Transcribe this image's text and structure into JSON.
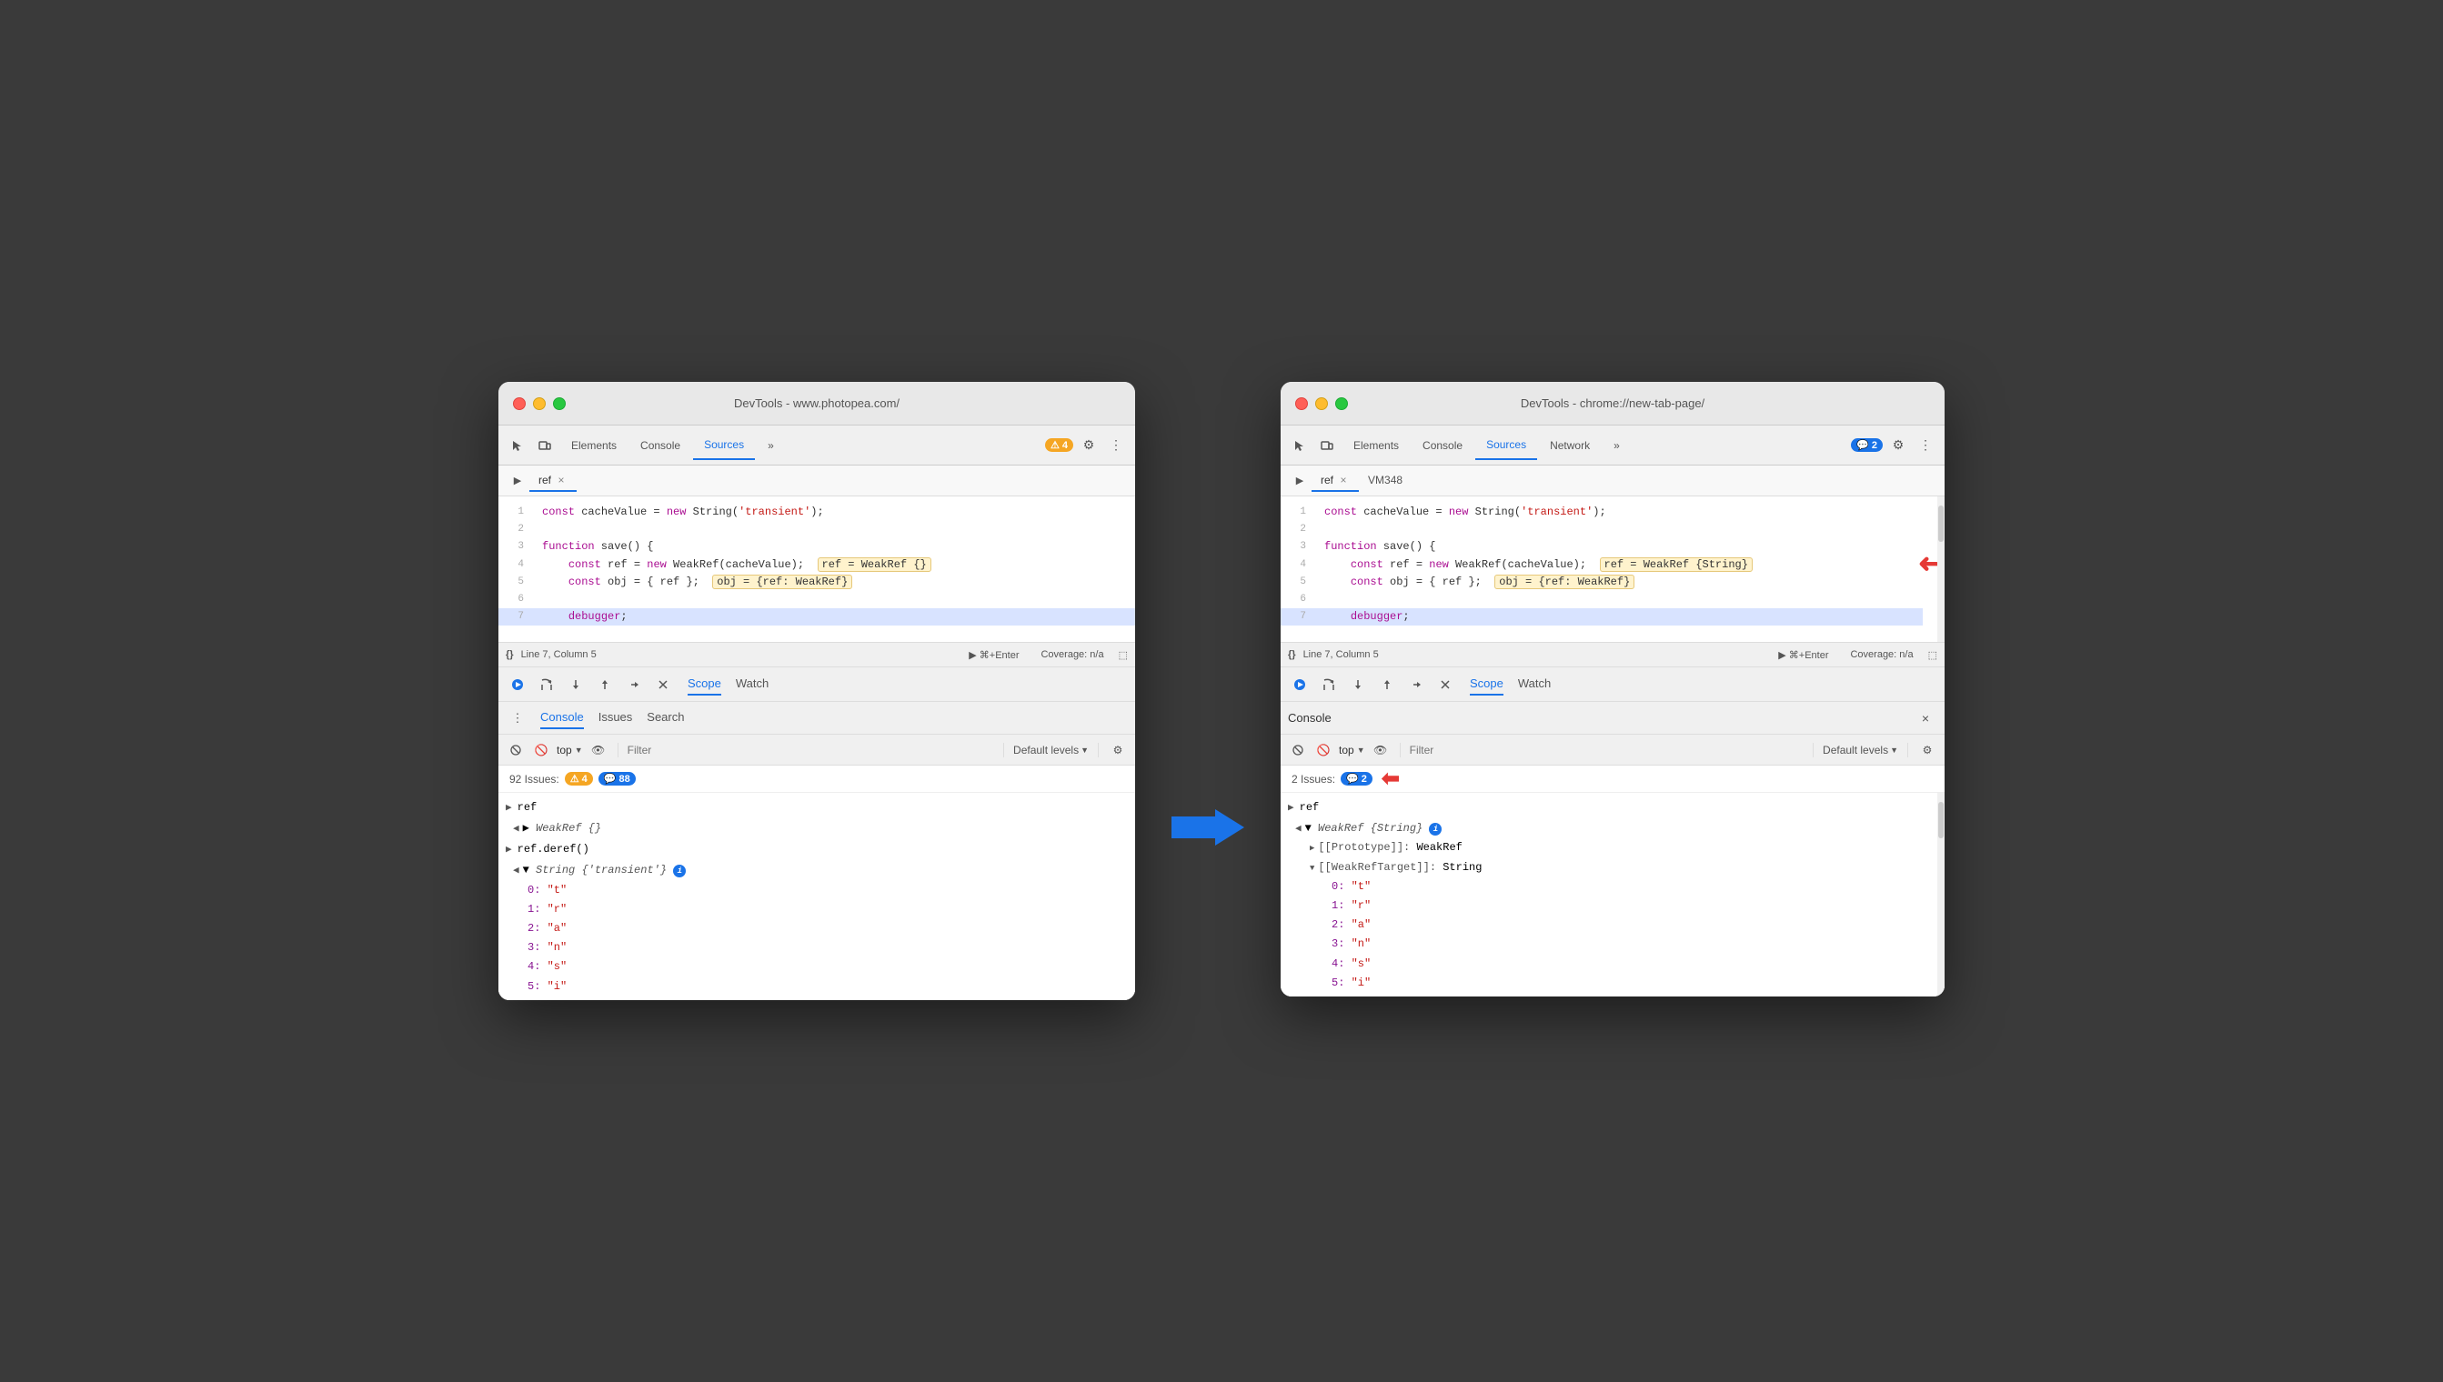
{
  "left_window": {
    "title": "DevTools - www.photopea.com/",
    "tabs": [
      "Elements",
      "Console",
      "Sources",
      "»"
    ],
    "active_tab": "Sources",
    "badge": "4",
    "file_tabs": [
      "ref"
    ],
    "code_lines": [
      {
        "num": 1,
        "content": "const cacheValue = new String('transient');"
      },
      {
        "num": 2,
        "content": ""
      },
      {
        "num": 3,
        "content": "function save() {"
      },
      {
        "num": 4,
        "content": "    const ref = new WeakRef(cacheValue);  ref = WeakRef {}"
      },
      {
        "num": 5,
        "content": "    const obj = { ref };  obj = {ref: WeakRef}"
      },
      {
        "num": 6,
        "content": ""
      },
      {
        "num": 7,
        "content": "    debugger;",
        "highlighted": true
      }
    ],
    "status": "Line 7, Column 5",
    "coverage": "n/a",
    "debug_tabs": [
      "Scope",
      "Watch"
    ],
    "active_debug_tab": "Scope",
    "console_tabs": [
      "Console",
      "Issues",
      "Search"
    ],
    "active_console_tab": "Console",
    "filter_placeholder": "Filter",
    "default_levels": "Default levels",
    "top_label": "top",
    "issues_count": "92 Issues:",
    "issues_warn": "4",
    "issues_info": "88",
    "console_rows": [
      {
        "type": "expand",
        "content": "ref"
      },
      {
        "type": "tree",
        "content": "WeakRef {}"
      },
      {
        "type": "expand",
        "content": "ref.deref()"
      },
      {
        "type": "tree",
        "content": "String {'transient'}"
      },
      {
        "type": "indent",
        "content": "0: \"t\""
      },
      {
        "type": "indent",
        "content": "1: \"r\""
      },
      {
        "type": "indent",
        "content": "2: \"a\""
      },
      {
        "type": "indent",
        "content": "3: \"n\""
      },
      {
        "type": "indent",
        "content": "4: \"s\""
      },
      {
        "type": "indent",
        "content": "5: \"i\""
      }
    ]
  },
  "right_window": {
    "title": "DevTools - chrome://new-tab-page/",
    "tabs": [
      "Elements",
      "Console",
      "Sources",
      "Network",
      "»"
    ],
    "active_tab": "Sources",
    "badge": "2",
    "file_tabs": [
      "ref",
      "VM348"
    ],
    "code_lines": [
      {
        "num": 1,
        "content": "const cacheValue = new String('transient');"
      },
      {
        "num": 2,
        "content": ""
      },
      {
        "num": 3,
        "content": "function save() {"
      },
      {
        "num": 4,
        "content": "    const ref = new WeakRef(cacheValue);  ref = WeakRef {String}"
      },
      {
        "num": 5,
        "content": "    const obj = { ref };  obj = {ref: WeakRef}"
      },
      {
        "num": 6,
        "content": ""
      },
      {
        "num": 7,
        "content": "    debugger;",
        "highlighted": true
      }
    ],
    "status": "Line 7, Column 5",
    "coverage": "n/a",
    "debug_tabs": [
      "Scope",
      "Watch"
    ],
    "active_debug_tab": "Scope",
    "filter_placeholder": "Filter",
    "default_levels": "Default levels",
    "top_label": "top",
    "console_title": "Console",
    "issues_count": "2 Issues:",
    "issues_info": "2",
    "console_rows": [
      {
        "type": "expand",
        "content": "ref"
      },
      {
        "type": "tree_open",
        "content": "WeakRef {String}"
      },
      {
        "type": "indent1",
        "content": "[[Prototype]]: WeakRef"
      },
      {
        "type": "indent1",
        "content": "[[WeakRefTarget]]: String"
      },
      {
        "type": "indent2",
        "content": "0: \"t\""
      },
      {
        "type": "indent2",
        "content": "1: \"r\""
      },
      {
        "type": "indent2",
        "content": "2: \"a\""
      },
      {
        "type": "indent2",
        "content": "3: \"n\""
      },
      {
        "type": "indent2",
        "content": "4: \"s\""
      },
      {
        "type": "indent2",
        "content": "5: \"i\""
      }
    ]
  },
  "icons": {
    "cursor": "⬡",
    "layers": "⬚",
    "more": "»",
    "settings": "⚙",
    "kebab": "⋮",
    "play": "▶",
    "pause": "⏸",
    "step_over": "↷",
    "step_into": "↓",
    "step_out": "↑",
    "step_back": "↩",
    "deactivate": "⊘",
    "reload": "↺",
    "close": "×",
    "expand": "▶",
    "collapse": "▼",
    "no_entry": "🚫",
    "eye": "👁",
    "filter": "▽"
  }
}
